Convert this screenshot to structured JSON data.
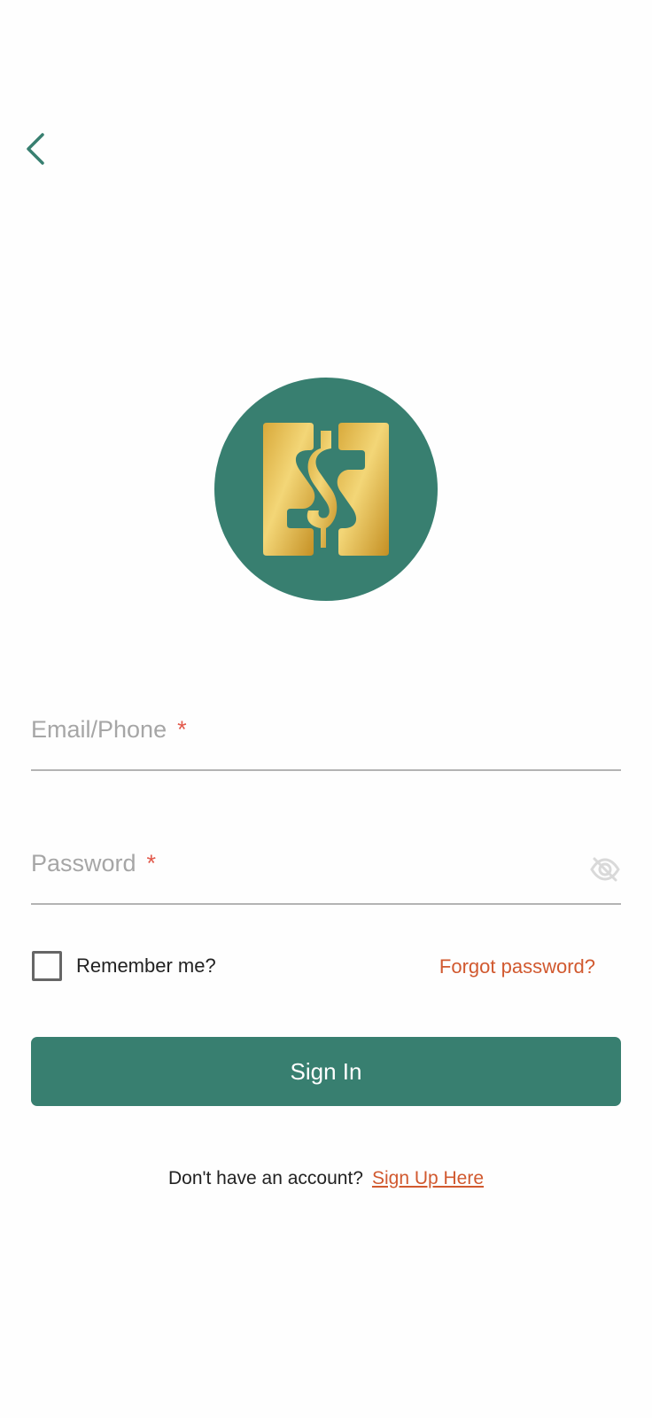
{
  "header": {
    "back_icon": "chevron-left-icon"
  },
  "logo": {
    "icon": "dollar-sign-logo",
    "background_color": "#387f70",
    "gold_color": "#e6bd4e"
  },
  "form": {
    "email_label": "Email/Phone",
    "email_required_mark": "*",
    "email_value": "",
    "password_label": "Password",
    "password_required_mark": "*",
    "password_value": "",
    "password_toggle_icon": "eye-off-icon",
    "remember_label": "Remember me?",
    "remember_checked": false,
    "forgot_label": "Forgot password?",
    "submit_label": "Sign In"
  },
  "footer": {
    "prompt": "Don't have an account?",
    "signup_label": "Sign Up Here"
  },
  "colors": {
    "primary": "#387f70",
    "accent": "#d1592f",
    "required": "#e25a4c"
  }
}
